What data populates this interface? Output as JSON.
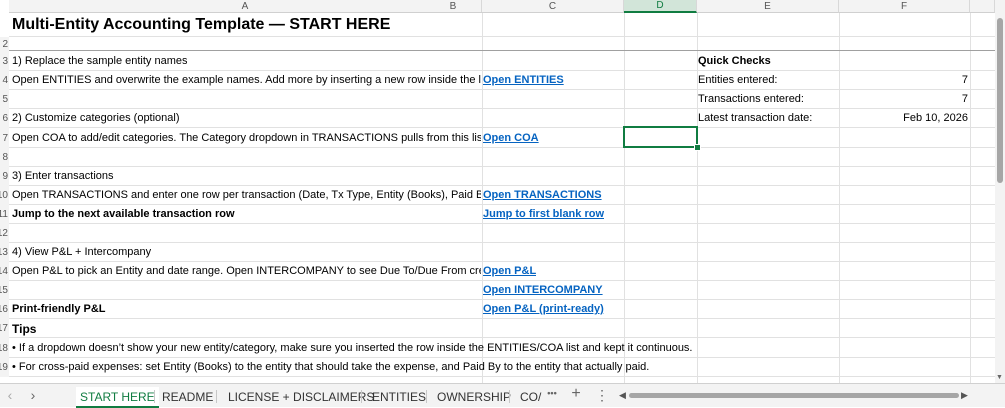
{
  "columns": [
    "A",
    "B",
    "C",
    "D",
    "E",
    "F"
  ],
  "selected_column": "D",
  "row_numbers": [
    "",
    "2",
    "3",
    "4",
    "5",
    "6",
    "7",
    "8",
    "9",
    "10",
    "11",
    "12",
    "13",
    "14",
    "15",
    "16",
    "17",
    "18",
    "19"
  ],
  "title": "Multi-Entity Accounting Template — START HERE",
  "steps": {
    "s1_heading": "1) Replace the sample entity names",
    "s1_text": "Open ENTITIES and overwrite the example names. Add more by inserting a new row inside the list (k",
    "s1_link": "Open ENTITIES",
    "s2_heading": "2) Customize categories (optional)",
    "s2_text": "Open COA to add/edit categories. The Category dropdown in TRANSACTIONS pulls from this list.",
    "s2_link": "Open COA",
    "s3_heading": "3) Enter transactions",
    "s3_text": "Open TRANSACTIONS and enter one row per transaction (Date, Tx Type, Entity (Books), Paid By/Rece",
    "s3_link": "Open TRANSACTIONS",
    "s3_jump_text": "Jump to the next available transaction row",
    "s3_jump_link": "Jump to first blank row",
    "s4_heading": "4) View P&L + Intercompany",
    "s4_text": "Open P&L to pick an Entity and date range. Open INTERCOMPANY to see Due To/Due From created I",
    "s4_link1": "Open P&L",
    "s4_link2": "Open INTERCOMPANY",
    "print_text": "Print-friendly P&L",
    "print_link": "Open P&L (print-ready)",
    "tips_heading": "Tips",
    "tip1": "• If a dropdown doesn’t show your new entity/category, make sure you inserted the row inside the ENTITIES/COA list and kept it continuous.",
    "tip2": "• For cross-paid expenses: set Entity (Books) to the entity that should take the expense, and Paid By to the entity that actually paid."
  },
  "quick_checks": {
    "heading": "Quick Checks",
    "rows": [
      {
        "label": "Entities entered:",
        "value": "7"
      },
      {
        "label": "Transactions entered:",
        "value": "7"
      },
      {
        "label": "Latest transaction date:",
        "value": "Feb 10, 2026"
      }
    ]
  },
  "tabs": [
    "START HERE",
    "README",
    "LICENSE + DISCLAIMERS",
    "ENTITIES",
    "OWNERSHIP",
    "CO/"
  ],
  "active_tab": "START HERE",
  "tabbar_icons": {
    "prev": "‹",
    "next": "›",
    "more": "•••",
    "add": "+",
    "menu": "⋮"
  }
}
